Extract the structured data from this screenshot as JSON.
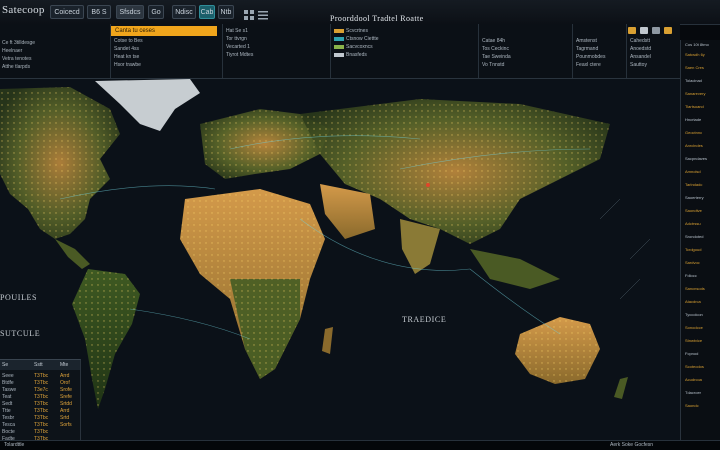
{
  "app": {
    "logo": "Satecoop",
    "title": "Proorddool Tradtel Roatte"
  },
  "toolbar": {
    "buttons": [
      {
        "label": "Coicecd"
      },
      {
        "label": "B6 S"
      },
      {
        "label": "Sfsdcs"
      },
      {
        "label": "Go"
      },
      {
        "label": "Ndisc"
      },
      {
        "label": "Cab"
      },
      {
        "label": "Ntb"
      }
    ]
  },
  "header": {
    "left_lines": [
      "Ce ft 3tilldesge",
      "Heelnaer",
      "Vetra tenotes",
      "Atthe tlarpds"
    ],
    "yellow_bar": "Canta tu ceses",
    "cols": [
      {
        "lines": [
          "Cotse to Bes",
          "Sandet 4ss",
          "Heat kn tse",
          "Hsor trawbe"
        ]
      },
      {
        "lines": [
          "Hat Se s1",
          "Tor ttvrgn",
          "Vecarted 1",
          "Tiyrot Mdtes"
        ]
      },
      {
        "lines": [
          "Scvcrtnes",
          "Ctsnow Ciettte",
          "Sacvcoxncs",
          "Bnasfeds"
        ]
      },
      {
        "lines": [
          "Catae 84h",
          "Tos Ceckinc",
          "Tae Sweinda",
          "Vo Tnnstd"
        ]
      },
      {
        "lines": [
          "Amstenst",
          "Tagrmand",
          "Pounmobdes",
          "Feaxl ctere"
        ]
      },
      {
        "lines": [
          "Cahedstt",
          "Anoedstd",
          "Ansandel",
          "Sauttoy"
        ]
      }
    ]
  },
  "map": {
    "labels": {
      "left1": "POUILES",
      "left2": "SUTCULE",
      "center": "TRAEDICE"
    }
  },
  "right_panel": {
    "header": "Cos 10t 8tmo",
    "rows": [
      "Satcsdh 6y",
      "Saen Cres",
      "Tolacinad",
      "Sanarevery",
      "Tiartsoand",
      "Hncrtade",
      "Geoctnnc",
      "Anrclndes",
      "Sacpndaves",
      "Amnolsd",
      "Tarlndadc",
      "Saoerterry",
      "Saondtve",
      "Adctrssu",
      "Srondoted",
      "Tcrdgoud",
      "Sardvoc",
      "Fdlocc",
      "Sancnsods",
      "Atacdrca",
      "Tyccolcon",
      "Sonodcce",
      "Stnwtvice",
      "Fcpnod",
      "Scoteodos",
      "Acudrcoa",
      "Tdacroer",
      "Saondc"
    ]
  },
  "bottom_table": {
    "headers": [
      "Se",
      "Sstt",
      "Mte"
    ],
    "rows": [
      [
        "Seee",
        "T3Tbc"
      ],
      [
        "Btdfe",
        "T3Tbc"
      ],
      [
        "Taswe",
        "T3e7c"
      ],
      [
        "Teat",
        "T3Tbc"
      ],
      [
        "Sedt",
        "T3Tbc"
      ],
      [
        "Ttte",
        "T3Tbc"
      ],
      [
        "Tesbr",
        "T3Tbc"
      ],
      [
        "Tesca",
        "T3Tbc"
      ],
      [
        "Bocte",
        "T3Tbc"
      ],
      [
        "Fadte",
        "T3Tbc"
      ]
    ],
    "col3": [
      "Arrd",
      "Orof",
      "Srofe",
      "Srefe",
      "Srtdd",
      "Arrd",
      "Srtd",
      "Sorfs"
    ]
  },
  "status": {
    "left": "Tolardttle",
    "right": "Aerk  Soke  Gocfesn"
  },
  "colors": {
    "accent": "#f0a51c",
    "teal": "#1b5f6a",
    "land": "#c8903f",
    "ocean": "#0b1118"
  }
}
